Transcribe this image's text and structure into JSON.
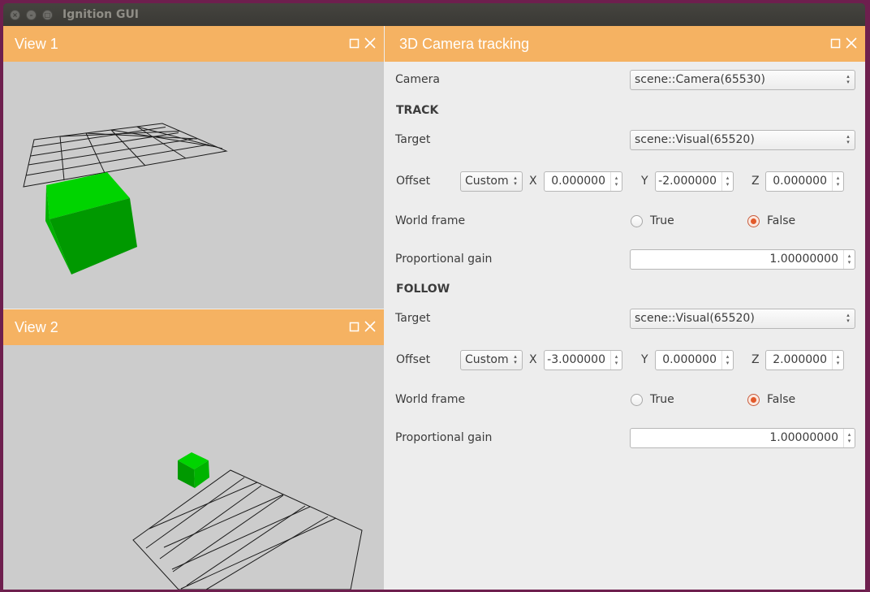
{
  "window": {
    "title": "Ignition GUI",
    "controls": [
      "close-icon",
      "minimize-icon",
      "maximize-icon"
    ]
  },
  "views": [
    {
      "title": "View 1"
    },
    {
      "title": "View 2"
    }
  ],
  "camera_panel": {
    "title": "3D Camera tracking",
    "camera_label": "Camera",
    "camera_value": "scene::Camera(65530)",
    "track": {
      "heading": "TRACK",
      "target_label": "Target",
      "target_value": "scene::Visual(65520)",
      "offset_label": "Offset",
      "offset_mode": "Custom",
      "x_label": "X",
      "x_value": "0.000000",
      "y_label": "Y",
      "y_value": "-2.000000",
      "z_label": "Z",
      "z_value": "0.000000",
      "world_frame_label": "World frame",
      "true_label": "True",
      "false_label": "False",
      "world_frame_selected": "False",
      "gain_label": "Proportional gain",
      "gain_value": "1.00000000"
    },
    "follow": {
      "heading": "FOLLOW",
      "target_label": "Target",
      "target_value": "scene::Visual(65520)",
      "offset_label": "Offset",
      "offset_mode": "Custom",
      "x_label": "X",
      "x_value": "-3.000000",
      "y_label": "Y",
      "y_value": "0.000000",
      "z_label": "Z",
      "z_value": "2.000000",
      "world_frame_label": "World frame",
      "true_label": "True",
      "false_label": "False",
      "world_frame_selected": "False",
      "gain_label": "Proportional gain",
      "gain_value": "1.00000000"
    }
  },
  "colors": {
    "header": "#f5b262",
    "viewport_bg": "#cccccc",
    "cube_front": "#009900",
    "cube_top": "#00d400",
    "radio_accent": "#e25a2b"
  }
}
